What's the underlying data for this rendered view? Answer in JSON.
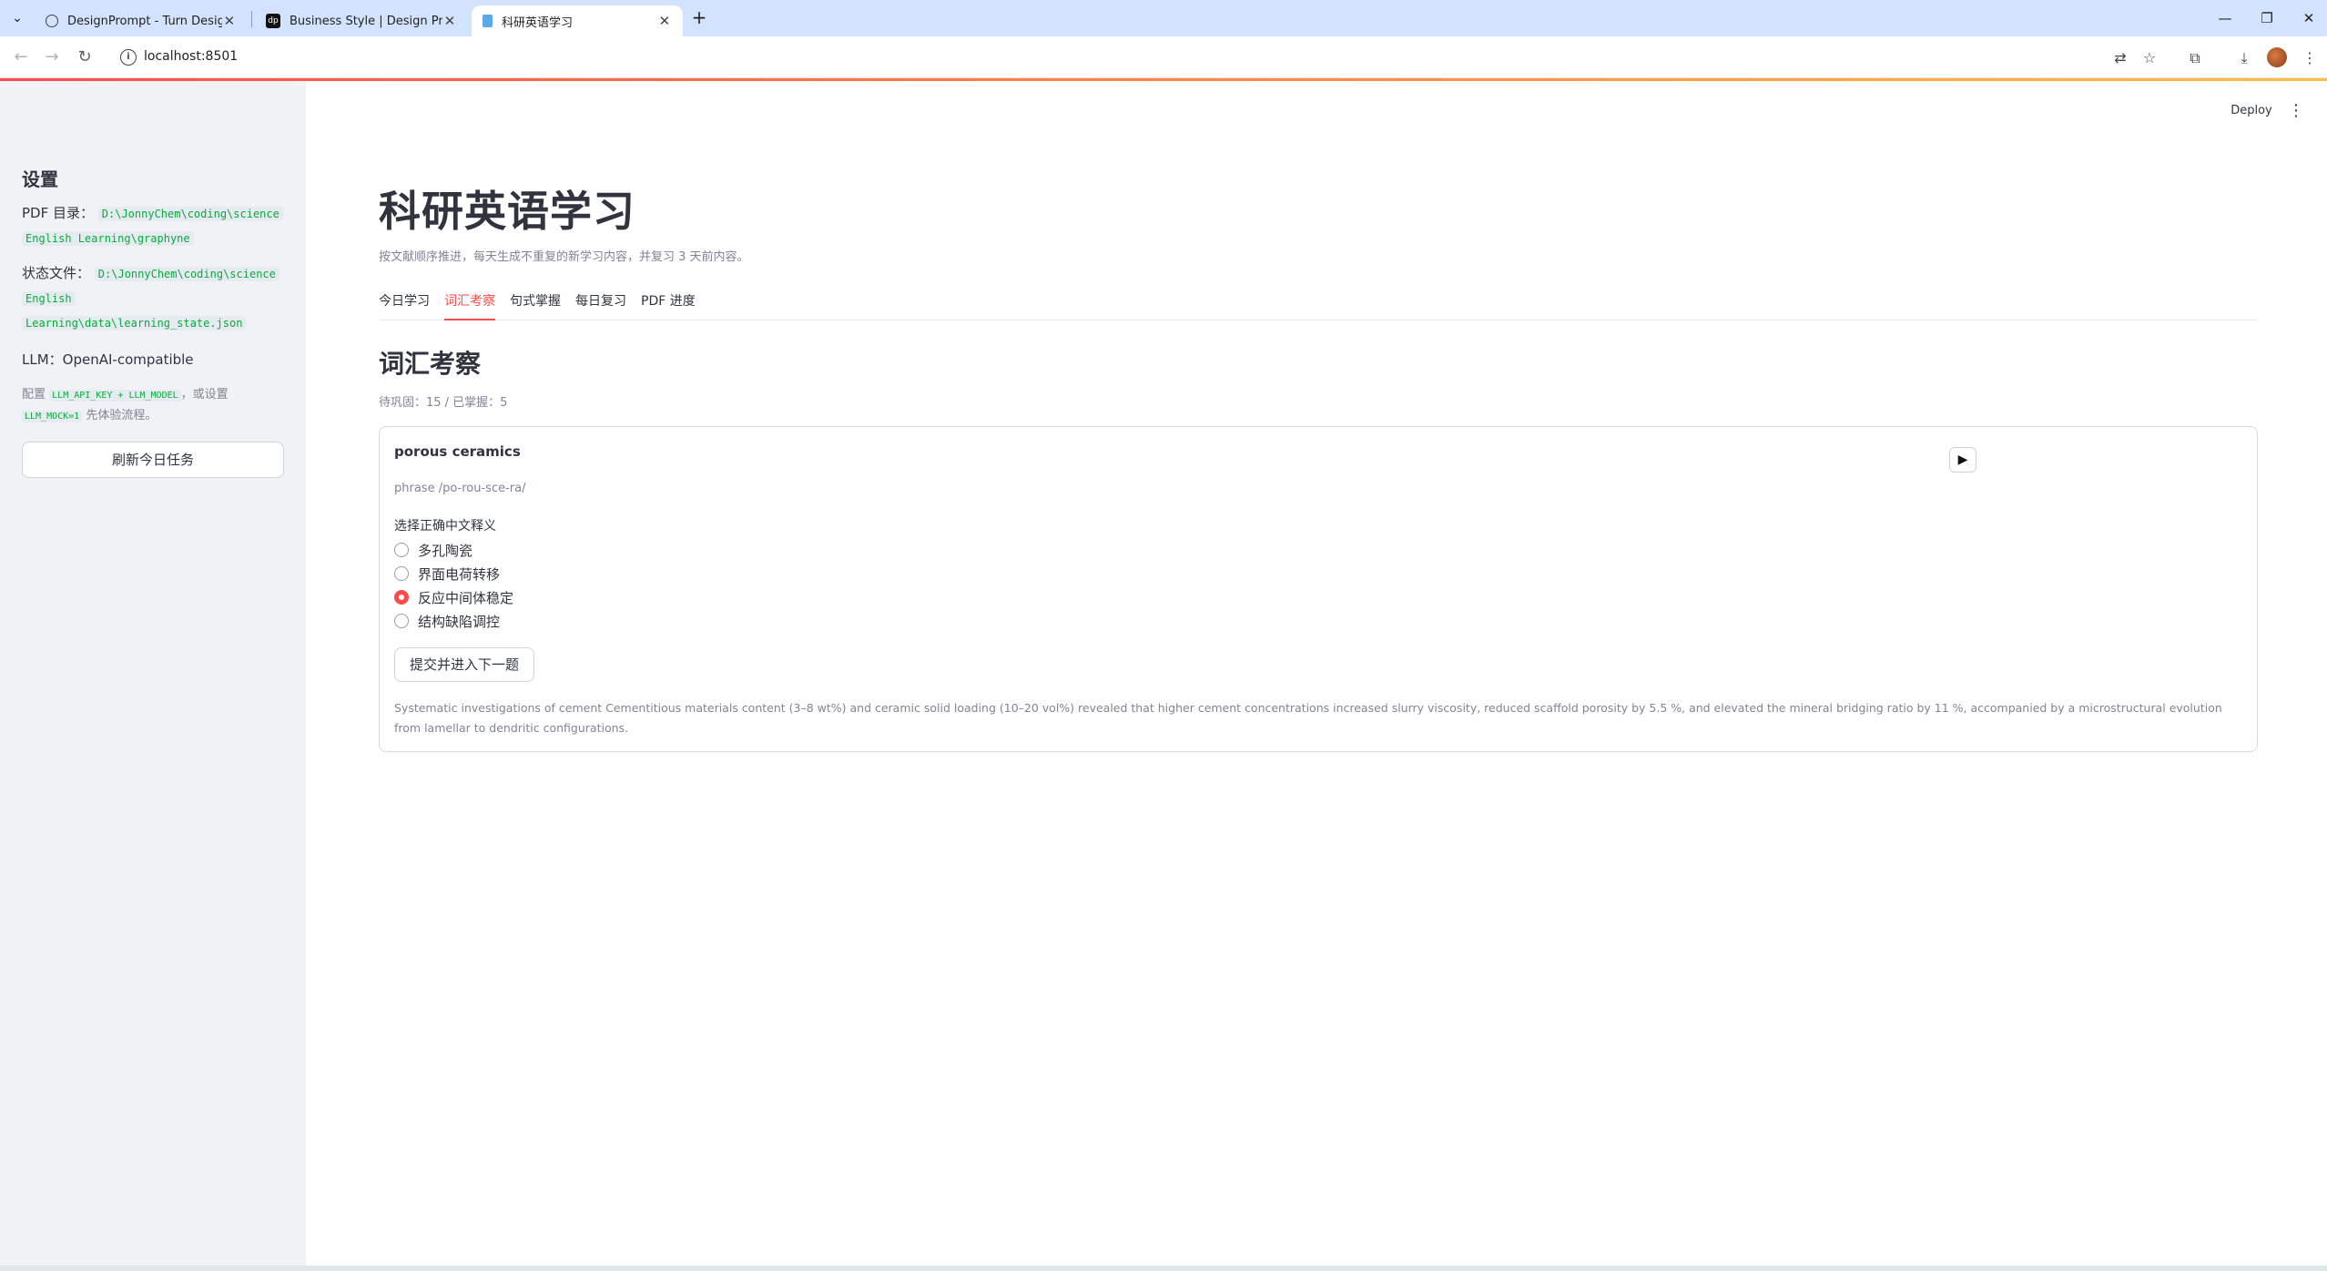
{
  "browser": {
    "tabs": [
      {
        "title": "DesignPrompt - Turn Design",
        "favicon": "globe-icon"
      },
      {
        "title": "Business Style | Design Prompt",
        "favicon": "dp-logo"
      },
      {
        "title": "科研英语学习",
        "favicon": "streamlit-doc-icon"
      }
    ],
    "url": "localhost:8501"
  },
  "sidebar": {
    "title": "设置",
    "pdf_label": "PDF 目录：",
    "pdf_path_line1": "D:\\JonnyChem\\coding\\science",
    "pdf_path_line2": "English Learning\\graphyne",
    "state_label": "状态文件：",
    "state_path_line1": "D:\\JonnyChem\\coding\\science",
    "state_path_line2": "English",
    "state_path_line3": "Learning\\data\\learning_state.json",
    "llm_label": "LLM：",
    "llm_value": "OpenAI-compatible",
    "note_prefix": "配置",
    "note_code1": "LLM_API_KEY + LLM_MODEL",
    "note_mid": "，或设置",
    "note_code2": "LLM_MOCK=1",
    "note_suffix": "先体验流程。",
    "refresh_button": "刷新今日任务"
  },
  "header": {
    "deploy": "Deploy",
    "menu_icon": "kebab-menu-icon"
  },
  "main": {
    "title": "科研英语学习",
    "caption": "按文献顺序推进，每天生成不重复的新学习内容，并复习 3 天前内容。",
    "tabs": [
      "今日学习",
      "词汇考察",
      "句式掌握",
      "每日复习",
      "PDF 进度"
    ],
    "active_tab": 1,
    "section_title": "词汇考察",
    "stats": "待巩固：15 / 已掌握：5"
  },
  "quiz": {
    "word": "porous ceramics",
    "phonetic": "phrase /po-rou-sce-ra/",
    "question": "选择正确中文释义",
    "options": [
      "多孔陶瓷",
      "界面电荷转移",
      "反应中间体稳定",
      "结构缺陷调控"
    ],
    "selected_index": 2,
    "submit": "提交并进入下一题",
    "context": "Systematic investigations of cement Cementitious materials content (3–8 wt%) and ceramic solid loading (10–20 vol%) revealed that higher cement concentrations increased slurry viscosity, reduced scaffold porosity by 5.5 %, and elevated the mineral bridging ratio by 11 %, accompanied by a microstructural evolution from lamellar to dendritic configurations."
  },
  "colors": {
    "accent": "#ff4b4b",
    "sidebar_bg": "#f0f2f6",
    "tabstrip_bg": "#d3e3fd",
    "code_text": "#09ab3b"
  }
}
